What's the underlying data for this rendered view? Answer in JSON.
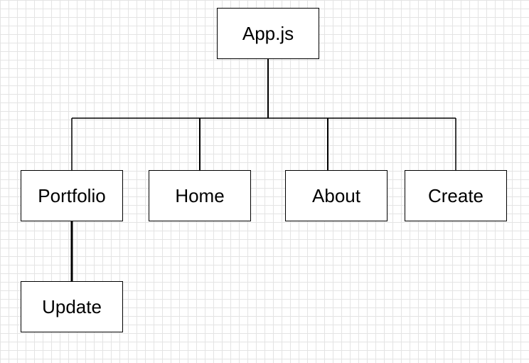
{
  "diagram": {
    "nodes": {
      "app": "App.js",
      "portfolio": "Portfolio",
      "home": "Home",
      "about": "About",
      "create": "Create",
      "update": "Update"
    },
    "edges": [
      {
        "from": "app",
        "to": "portfolio"
      },
      {
        "from": "app",
        "to": "home"
      },
      {
        "from": "app",
        "to": "about"
      },
      {
        "from": "app",
        "to": "create"
      },
      {
        "from": "portfolio",
        "to": "update"
      }
    ]
  }
}
